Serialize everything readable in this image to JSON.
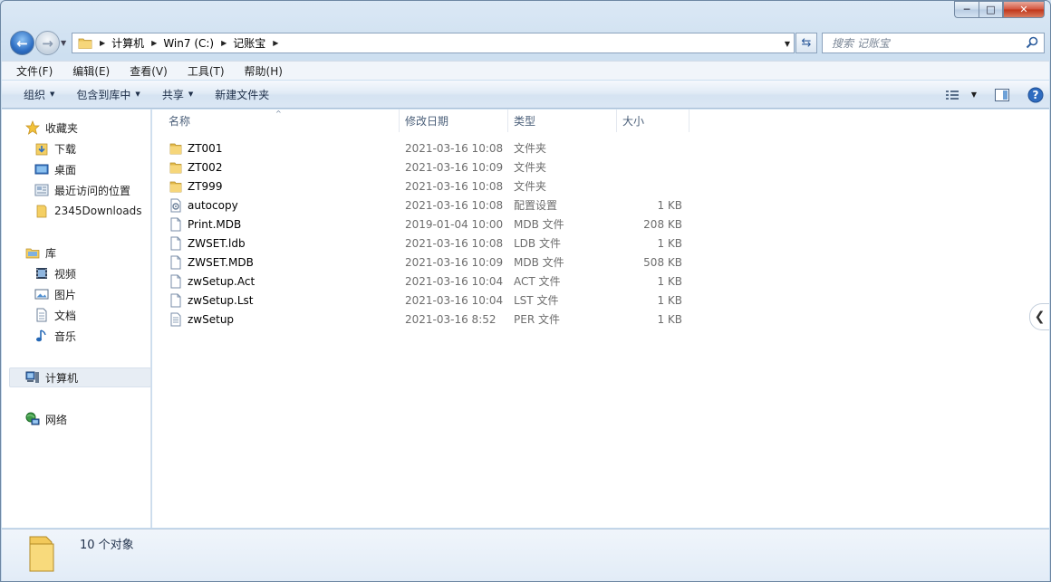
{
  "window": {
    "minimize_label": "─",
    "maximize_label": "□",
    "close_label": "✕"
  },
  "nav": {
    "back_glyph": "←",
    "forward_glyph": "→",
    "breadcrumb": [
      "计算机",
      "Win7 (C:)",
      "记账宝"
    ],
    "refresh_glyph": "⇆",
    "search_placeholder": "搜索 记账宝"
  },
  "menubar": [
    "文件(F)",
    "编辑(E)",
    "查看(V)",
    "工具(T)",
    "帮助(H)"
  ],
  "commandbar": {
    "organize": "组织",
    "include_library": "包含到库中",
    "share": "共享",
    "new_folder": "新建文件夹"
  },
  "sidebar": {
    "favorites": {
      "label": "收藏夹",
      "items": [
        "下载",
        "桌面",
        "最近访问的位置",
        "2345Downloads"
      ]
    },
    "libraries": {
      "label": "库",
      "items": [
        "视频",
        "图片",
        "文档",
        "音乐"
      ]
    },
    "computer": "计算机",
    "network": "网络"
  },
  "columns": {
    "name": "名称",
    "date": "修改日期",
    "type": "类型",
    "size": "大小"
  },
  "files": [
    {
      "name": "ZT001",
      "date": "2021-03-16 10:08",
      "type": "文件夹",
      "size": "",
      "icon": "folder-icon"
    },
    {
      "name": "ZT002",
      "date": "2021-03-16 10:09",
      "type": "文件夹",
      "size": "",
      "icon": "folder-icon"
    },
    {
      "name": "ZT999",
      "date": "2021-03-16 10:08",
      "type": "文件夹",
      "size": "",
      "icon": "folder-icon"
    },
    {
      "name": "autocopy",
      "date": "2021-03-16 10:08",
      "type": "配置设置",
      "size": "1 KB",
      "icon": "config-file-icon"
    },
    {
      "name": "Print.MDB",
      "date": "2019-01-04 10:00",
      "type": "MDB 文件",
      "size": "208 KB",
      "icon": "file-icon"
    },
    {
      "name": "ZWSET.ldb",
      "date": "2021-03-16 10:08",
      "type": "LDB 文件",
      "size": "1 KB",
      "icon": "file-icon"
    },
    {
      "name": "ZWSET.MDB",
      "date": "2021-03-16 10:09",
      "type": "MDB 文件",
      "size": "508 KB",
      "icon": "file-icon"
    },
    {
      "name": "zwSetup.Act",
      "date": "2021-03-16 10:04",
      "type": "ACT 文件",
      "size": "1 KB",
      "icon": "file-icon"
    },
    {
      "name": "zwSetup.Lst",
      "date": "2021-03-16 10:04",
      "type": "LST 文件",
      "size": "1 KB",
      "icon": "file-icon"
    },
    {
      "name": "zwSetup",
      "date": "2021-03-16 8:52",
      "type": "PER 文件",
      "size": "1 KB",
      "icon": "text-file-icon"
    }
  ],
  "details": {
    "count_text": "10 个对象"
  }
}
